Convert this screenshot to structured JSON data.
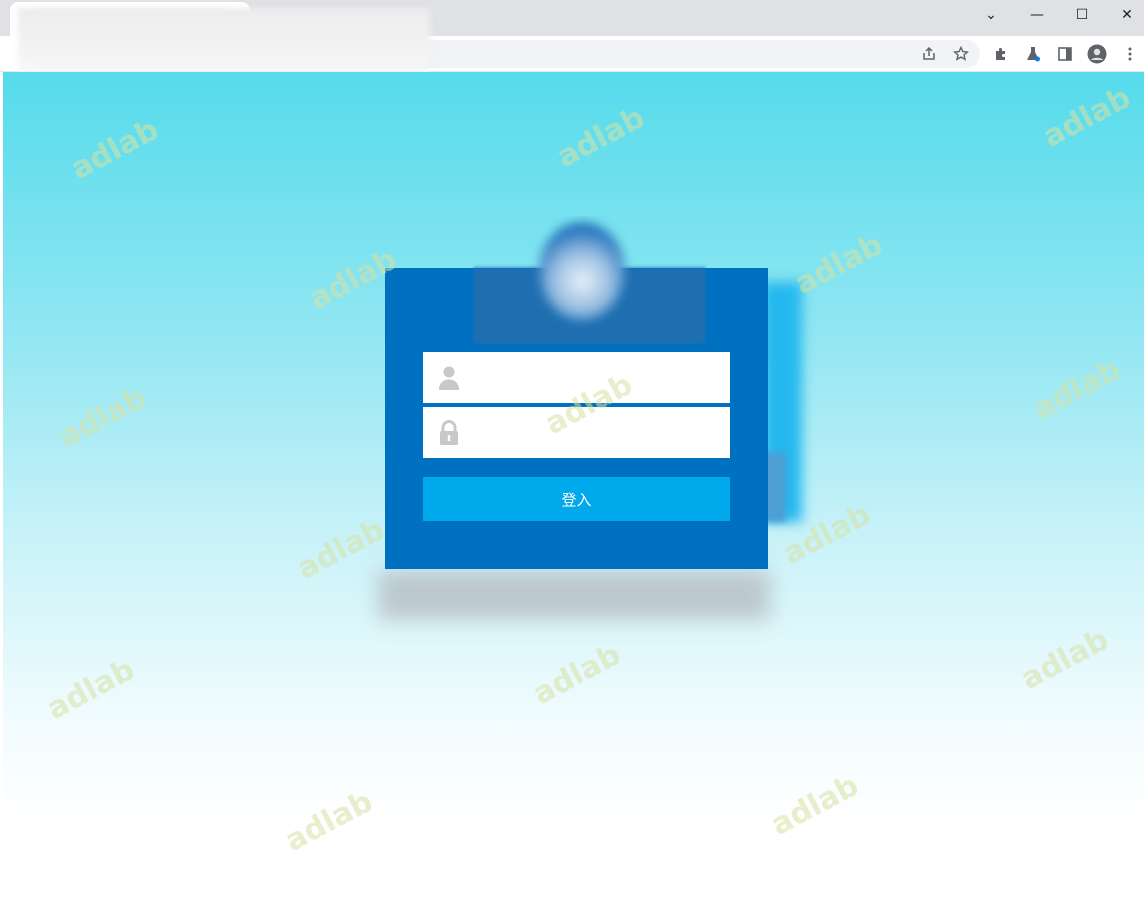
{
  "browser": {
    "window_controls": {
      "tab_search_glyph": "⌄",
      "minimize_glyph": "—",
      "maximize_glyph": "☐",
      "close_glyph": "✕"
    },
    "toolbar_icons": [
      "share-icon",
      "bookmark-star-icon",
      "extensions-icon",
      "labs-icon",
      "side-panel-icon",
      "profile-icon",
      "menu-icon"
    ]
  },
  "login": {
    "username_placeholder": "",
    "password_placeholder": "",
    "submit_label": "登入"
  },
  "watermark": {
    "text": "adlab"
  },
  "colors": {
    "panel": "#0070c0",
    "button": "#00a8ec",
    "background_top": "#55dbeb",
    "background_bottom": "#ffffff"
  }
}
